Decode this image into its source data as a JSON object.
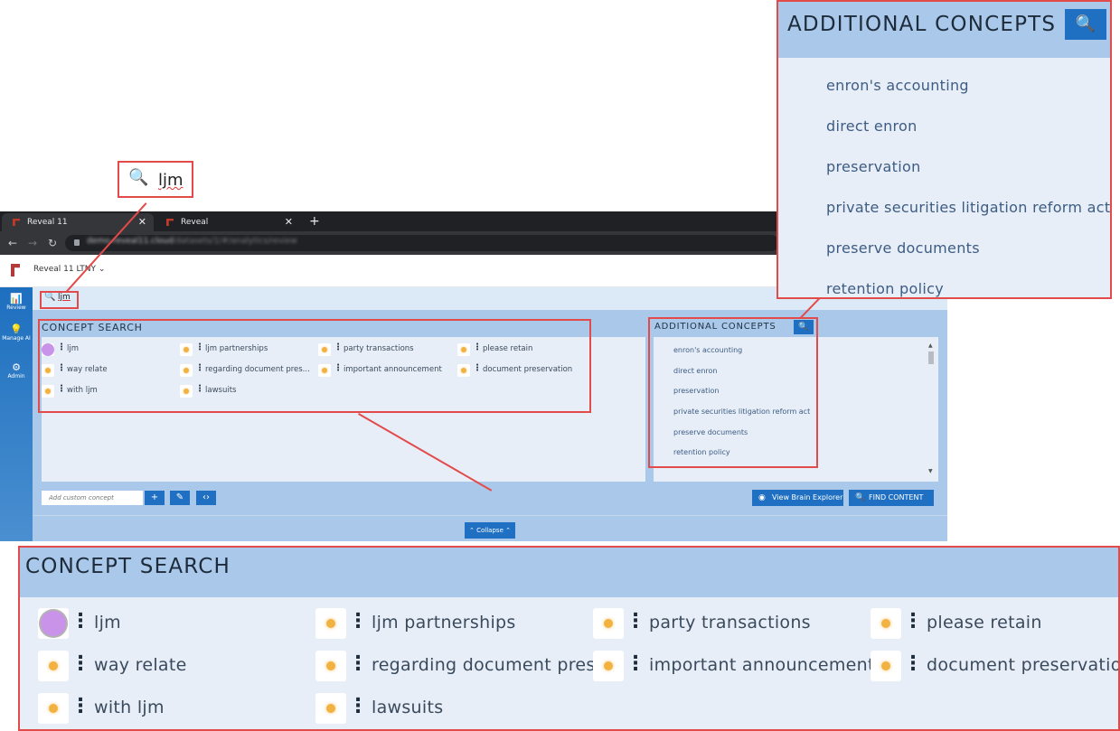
{
  "browser": {
    "tabs": [
      {
        "label": "Reveal 11",
        "active": true
      },
      {
        "label": "Reveal",
        "active": false
      }
    ],
    "url_host": "demo-reveal11.cloud",
    "url_path": "/datasets/1/#/analytics/review"
  },
  "app": {
    "project_name": "Reveal 11 LTNY",
    "nav": [
      {
        "label": "Review",
        "icon": "bar-chart-icon"
      },
      {
        "label": "Manage AI",
        "icon": "lightbulb-icon"
      },
      {
        "label": "Admin",
        "icon": "gear-icon"
      }
    ],
    "search_query": "ljm",
    "concept_search": {
      "title": "CONCEPT SEARCH",
      "concepts": [
        {
          "label": "ljm",
          "selected": true
        },
        {
          "label": "ljm partnerships",
          "selected": false
        },
        {
          "label": "party transactions",
          "selected": false
        },
        {
          "label": "please retain",
          "selected": false
        },
        {
          "label": "way relate",
          "selected": false
        },
        {
          "label": "regarding document pres...",
          "selected": false
        },
        {
          "label": "important announcement",
          "selected": false
        },
        {
          "label": "document preservation",
          "selected": false
        },
        {
          "label": "with ljm",
          "selected": false
        },
        {
          "label": "lawsuits",
          "selected": false
        }
      ]
    },
    "additional_concepts": {
      "title": "ADDITIONAL CONCEPTS",
      "items": [
        "enron's accounting",
        "direct enron",
        "preservation",
        "private securities litigation reform act",
        "preserve documents",
        "retention policy"
      ]
    },
    "custom_concept_placeholder": "Add custom concept",
    "view_brain_explorer_label": "View Brain Explorer",
    "find_content_label": "FIND CONTENT",
    "collapse_label": "Collapse"
  },
  "callouts": {
    "search": {
      "query": "ljm"
    },
    "additional": {
      "title": "ADDITIONAL CONCEPTS"
    },
    "concept": {
      "title": "CONCEPT SEARCH"
    }
  },
  "colors": {
    "accent": "#1f6fc2",
    "panel": "#a9c8ea",
    "panel_body": "#e7eef8",
    "callout_border": "#e34a4a",
    "concept_dot": "#f1b240",
    "selected_dot": "#c893e8"
  }
}
